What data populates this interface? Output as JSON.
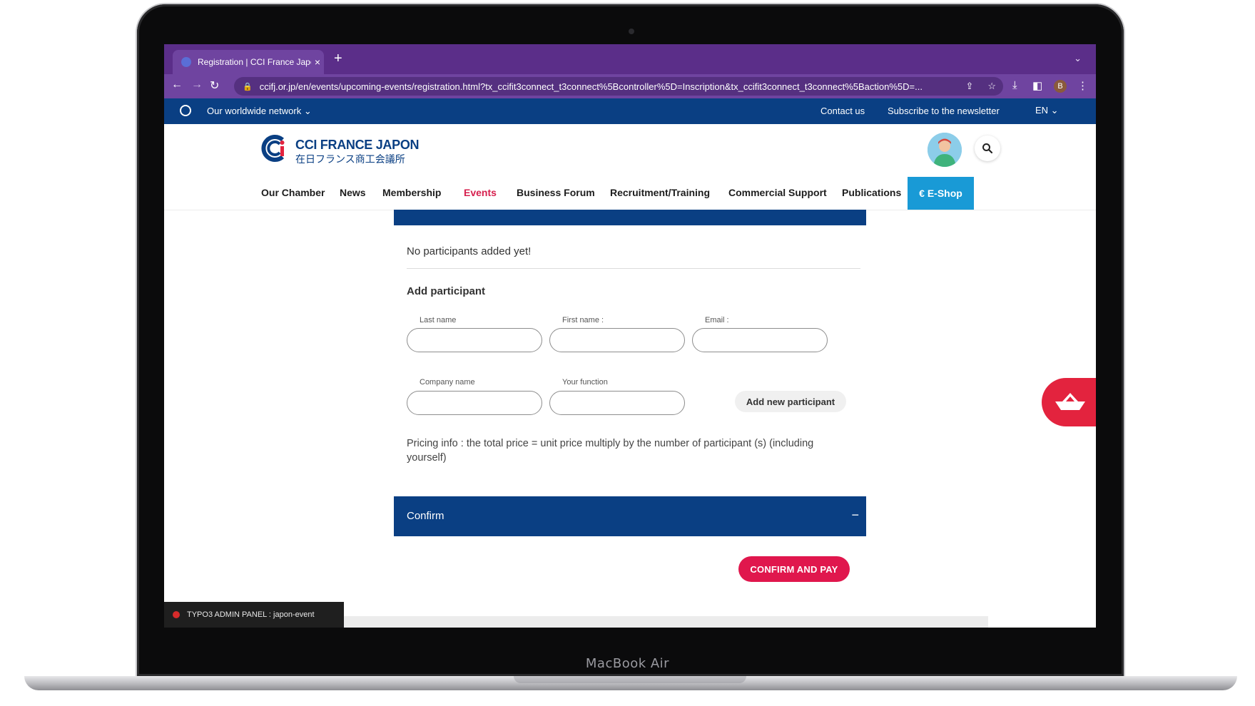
{
  "device": {
    "label": "MacBook Air"
  },
  "browser": {
    "tab_title": "Registration | CCI France Japo",
    "tab_close": "×",
    "new_tab": "+",
    "tab_menu": "⌄",
    "url": "ccifj.or.jp/en/events/upcoming-events/registration.html?tx_ccifit3connect_t3connect%5Bcontroller%5D=Inscription&tx_ccifit3connect_t3connect%5Baction%5D=...",
    "profile_initial": "B"
  },
  "utility_bar": {
    "network": "Our worldwide network ⌄",
    "contact": "Contact us",
    "newsletter": "Subscribe to the newsletter",
    "language": "EN ⌄"
  },
  "header": {
    "logo_line1": "CCI FRANCE JAPON",
    "logo_line2": "在日フランス商工会議所"
  },
  "nav": {
    "items": [
      "Our Chamber",
      "News",
      "Membership",
      "Events",
      "Business Forum",
      "Recruitment/Training",
      "Commercial Support",
      "Publications"
    ],
    "active": "Events",
    "eshop": "€ E-Shop"
  },
  "form": {
    "no_participants": "No participants added yet!",
    "add_participant_title": "Add participant",
    "fields": {
      "last_name": "Last name",
      "first_name": "First name :",
      "email": "Email :",
      "company_name": "Company name",
      "your_function": "Your function"
    },
    "add_new_button": "Add new participant",
    "pricing_info": "Pricing info : the total price = unit price multiply by the number of participant (s) (including yourself)"
  },
  "confirm": {
    "title": "Confirm",
    "toggle": "−",
    "pay_button": "CONFIRM AND PAY"
  },
  "admin": {
    "panel_label": "TYPO3 ADMIN PANEL : japon-event"
  },
  "colors": {
    "brand_blue": "#0a3f83",
    "accent_red": "#e0174d",
    "eshop_blue": "#199ad6",
    "browser_purple": "#6f44a0"
  }
}
